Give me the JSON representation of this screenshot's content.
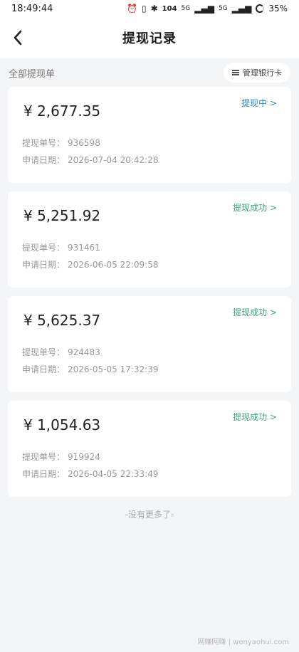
{
  "status_bar": {
    "time": "18:49:44",
    "net_speed": "104",
    "net_unit": "KB/S",
    "signal1": "5G",
    "signal2": "5G",
    "battery": "35%"
  },
  "nav": {
    "title": "提现记录"
  },
  "section": {
    "title": "全部提现单",
    "manage_label": "管理银行卡"
  },
  "labels": {
    "order_no": "提现单号：",
    "apply_date": "申请日期："
  },
  "records": [
    {
      "amount": "¥ 2,677.35",
      "status": "提现中 >",
      "status_type": "pending",
      "order_no": "936598",
      "date": "2026-07-04 20:42:28"
    },
    {
      "amount": "¥ 5,251.92",
      "status": "提现成功 >",
      "status_type": "success",
      "order_no": "931461",
      "date": "2026-06-05 22:09:58"
    },
    {
      "amount": "¥ 5,625.37",
      "status": "提现成功 >",
      "status_type": "success",
      "order_no": "924483",
      "date": "2026-05-05 17:32:39"
    },
    {
      "amount": "¥ 1,054.63",
      "status": "提现成功 >",
      "status_type": "success",
      "order_no": "919924",
      "date": "2026-04-05 22:33:49"
    }
  ],
  "footer": {
    "no_more": "-没有更多了-",
    "watermark": "网赚网赚 | wenyaohui.com"
  },
  "colors": {
    "pending": "#2e8bc0",
    "success": "#3aa57a",
    "background": "#f4f5f7"
  }
}
